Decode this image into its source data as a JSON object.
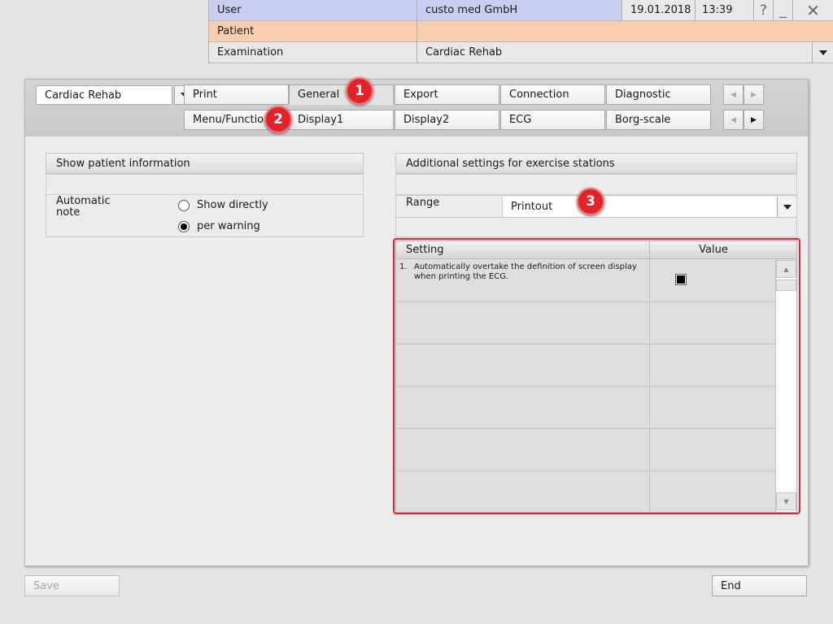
{
  "header": {
    "user_label": "User",
    "user_value": "custo med GmbH",
    "date": "19.01.2018",
    "time": "13:39",
    "help_glyph": "?",
    "minimize_glyph": "_",
    "close_glyph": "✕",
    "patient_label": "Patient",
    "patient_value": "",
    "exam_label": "Examination",
    "exam_value": "Cardiac Rehab",
    "colors": {
      "user_row": "#c9cdf0",
      "patient_row": "#f9cfb0"
    }
  },
  "toolbar": {
    "mode_value": "Cardiac Rehab",
    "tabs_row1": [
      "Print",
      "General",
      "Export",
      "Connection",
      "Diagnostic"
    ],
    "tabs_row2": [
      "Menu/Functions",
      "Display1",
      "Display2",
      "ECG",
      "Borg-scale"
    ],
    "active_tab": "General",
    "nav_prev_glyph": "◀",
    "nav_next_glyph": "▶"
  },
  "patient_info": {
    "title": "Show patient information",
    "auto_note_label": "Automatic\nnote",
    "options": [
      "Show directly",
      "per warning"
    ],
    "selected": "per warning"
  },
  "exercise": {
    "title": "Additional settings for exercise stations",
    "range_label": "Range",
    "range_value": "Printout",
    "table": {
      "col_setting": "Setting",
      "col_value": "Value",
      "rows": [
        {
          "num": "1.",
          "text": "Automatically overtake  the definition of screen display when printing the ECG.",
          "checked": true
        }
      ]
    },
    "scroll_up_glyph": "▲",
    "scroll_down_glyph": "▼"
  },
  "footer": {
    "save_label": "Save",
    "end_label": "End"
  },
  "annotations": [
    "1",
    "2",
    "3"
  ],
  "annotation_color": "#e2232a"
}
